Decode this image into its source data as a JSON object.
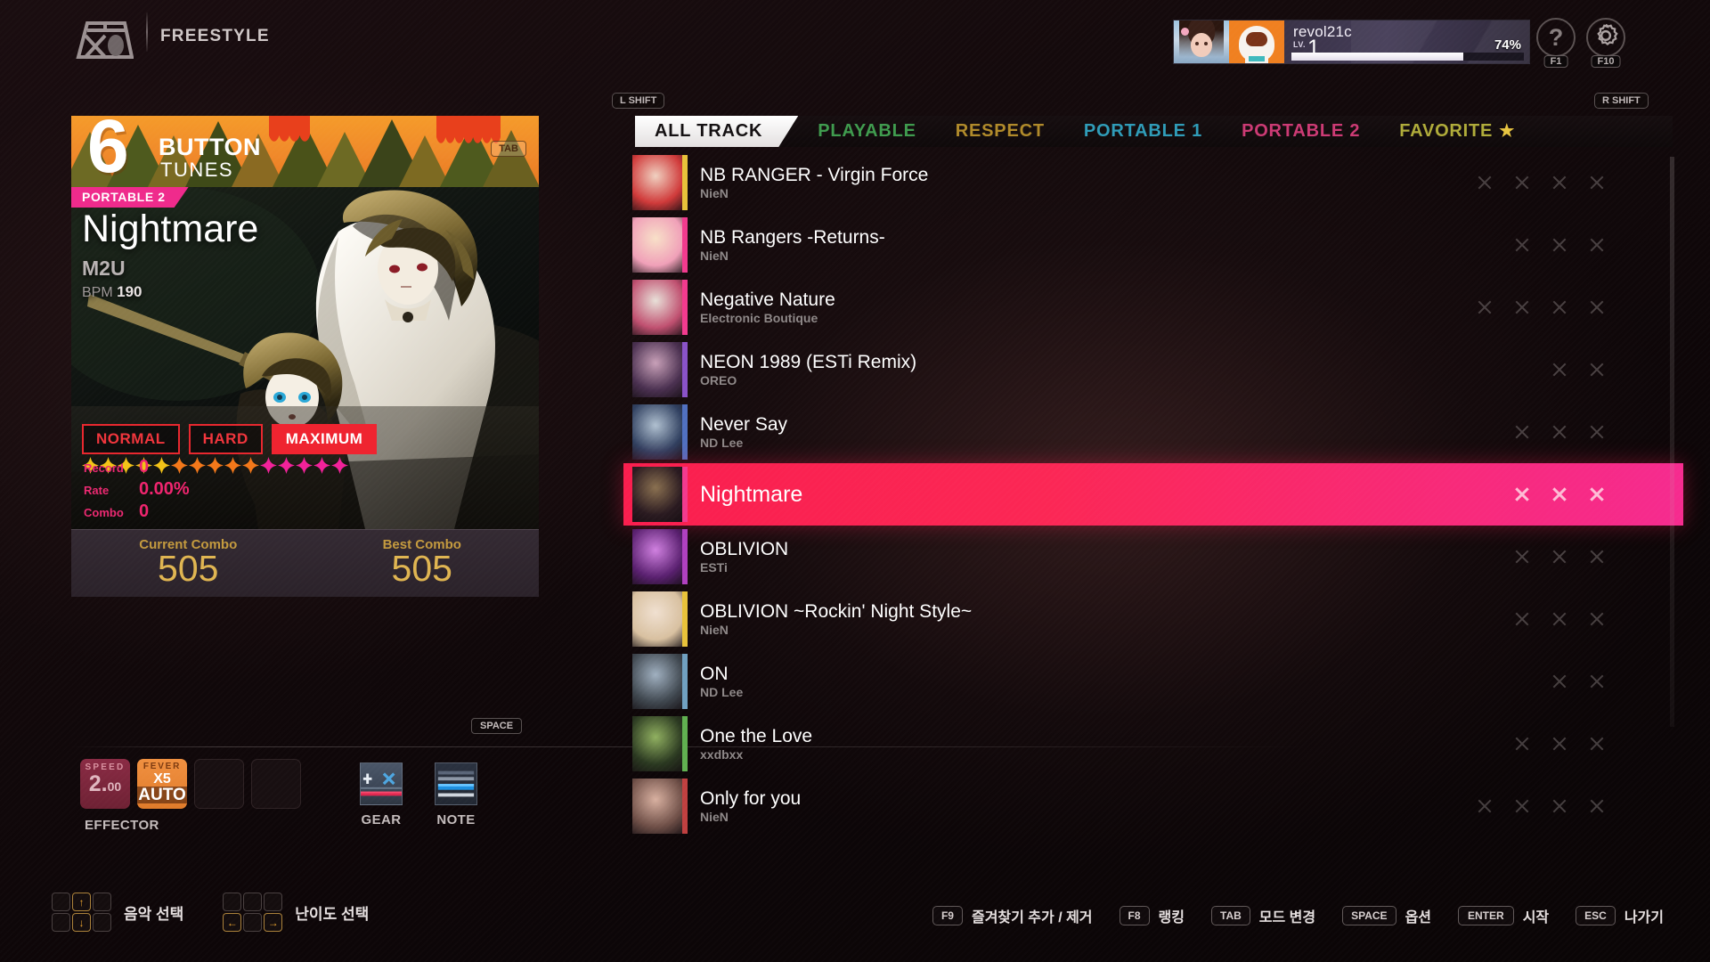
{
  "header": {
    "mode_label": "FREESTYLE",
    "mode_icon": "djmax-gear-logo-icon",
    "profile": {
      "name": "revol21c",
      "level_label": "LV.",
      "level_value": "1",
      "exp_percent_label": "74%",
      "exp_percent": 74
    },
    "help_button": {
      "glyph": "?",
      "key": "F1"
    },
    "settings_button": {
      "glyph": "gear",
      "key": "F10"
    }
  },
  "left_panel": {
    "banner": {
      "number": "6",
      "line1": "BUTTON",
      "line2": "TUNES",
      "key_hint": "TAB"
    },
    "song": {
      "category_badge": "PORTABLE 2",
      "title": "Nightmare",
      "artist": "M2U",
      "bpm_label": "BPM",
      "bpm_value": "190"
    },
    "difficulties": [
      {
        "label": "NORMAL",
        "selected": false
      },
      {
        "label": "HARD",
        "selected": false
      },
      {
        "label": "MAXIMUM",
        "selected": true
      }
    ],
    "star_rating": {
      "total": 15,
      "yellow": 5,
      "orange": 5,
      "pink": 5
    },
    "record": [
      {
        "label": "Record",
        "value": "0"
      },
      {
        "label": "Rate",
        "value": "0.00%"
      },
      {
        "label": "Combo",
        "value": "0"
      }
    ],
    "combo_panel": [
      {
        "label": "Current Combo",
        "value": "505"
      },
      {
        "label": "Best Combo",
        "value": "505"
      }
    ],
    "space_key_hint": "SPACE",
    "effector": {
      "label": "EFFECTOR",
      "slots": [
        {
          "type": "speed",
          "cap": "SPEED",
          "value": "2.",
          "value_small": "00"
        },
        {
          "type": "fever",
          "cap": "FEVER",
          "line1": "X5",
          "line2": "AUTO"
        },
        {
          "type": "empty"
        },
        {
          "type": "empty"
        }
      ]
    },
    "gear": {
      "label": "GEAR",
      "icon": "gear-skin-icon"
    },
    "note": {
      "label": "NOTE",
      "icon": "note-skin-icon"
    }
  },
  "tracklist": {
    "left_shift_key": "L SHIFT",
    "right_shift_key": "R SHIFT",
    "tabs": [
      {
        "label": "ALL TRACK",
        "state": "active"
      },
      {
        "label": "PLAYABLE",
        "state": "playable"
      },
      {
        "label": "RESPECT",
        "state": "respect"
      },
      {
        "label": "PORTABLE 1",
        "state": "p1"
      },
      {
        "label": "PORTABLE 2",
        "state": "p2"
      },
      {
        "label": "FAVORITE",
        "state": "fav",
        "star": "★"
      }
    ],
    "rows": [
      {
        "title": "NB RANGER - Virgin Force",
        "artist": "NieN",
        "edge": "#e8c23a",
        "thumb_a": "#d03a3a",
        "thumb_b": "#f0d0c0",
        "marks": 4,
        "selected": false
      },
      {
        "title": "NB Rangers -Returns-",
        "artist": "NieN",
        "edge": "#f23a8e",
        "thumb_a": "#f0a0b8",
        "thumb_b": "#f8e0c8",
        "marks": 3,
        "selected": false
      },
      {
        "title": "Negative Nature",
        "artist": "Electronic Boutique",
        "edge": "#f23a8e",
        "thumb_a": "#c05070",
        "thumb_b": "#e8e0d8",
        "marks": 4,
        "selected": false
      },
      {
        "title": "NEON 1989 (ESTi Remix)",
        "artist": "OREO",
        "edge": "#8a52c8",
        "thumb_a": "#4a3050",
        "thumb_b": "#c8a0b8",
        "marks": 2,
        "selected": false
      },
      {
        "title": "Never Say",
        "artist": "ND Lee",
        "edge": "#5070c0",
        "thumb_a": "#304060",
        "thumb_b": "#b0c0d0",
        "marks": 3,
        "selected": false
      },
      {
        "title": "Nightmare",
        "artist": "",
        "edge": "#f23a8e",
        "thumb_a": "#2a1a20",
        "thumb_b": "#8a7050",
        "marks": 3,
        "selected": true
      },
      {
        "title": "OBLIVION",
        "artist": "ESTi",
        "edge": "#b040c0",
        "thumb_a": "#5a2070",
        "thumb_b": "#d080e0",
        "marks": 3,
        "selected": false
      },
      {
        "title": "OBLIVION ~Rockin' Night Style~",
        "artist": "NieN",
        "edge": "#e8c23a",
        "thumb_a": "#d8c0a0",
        "thumb_b": "#f0e0d0",
        "marks": 3,
        "selected": false
      },
      {
        "title": "ON",
        "artist": "ND Lee",
        "edge": "#70a0c0",
        "thumb_a": "#404850",
        "thumb_b": "#a0b0c0",
        "marks": 2,
        "selected": false
      },
      {
        "title": "One the Love",
        "artist": "xxdbxx",
        "edge": "#60b050",
        "thumb_a": "#2a3820",
        "thumb_b": "#90b060",
        "marks": 3,
        "selected": false
      },
      {
        "title": "Only for you",
        "artist": "NieN",
        "edge": "#c04040",
        "thumb_a": "#705048",
        "thumb_b": "#d8b0a0",
        "marks": 4,
        "selected": false
      }
    ]
  },
  "bottom_bar": {
    "key_clusters": [
      {
        "label": "음악 선택",
        "type": "vertical"
      },
      {
        "label": "난이도 선택",
        "type": "horizontal"
      }
    ],
    "commands": [
      {
        "key": "F9",
        "text": "즐겨찾기 추가 / 제거"
      },
      {
        "key": "F8",
        "text": "랭킹"
      },
      {
        "key": "TAB",
        "text": "모드 변경"
      },
      {
        "key": "SPACE",
        "text": "옵션"
      },
      {
        "key": "ENTER",
        "text": "시작"
      },
      {
        "key": "ESC",
        "text": "나가기"
      }
    ]
  },
  "colors": {
    "selection_pink": "#fa1e4e",
    "accent_magenta": "#f0256f",
    "gold": "#e0b551",
    "banner_orange": "#f0892a"
  }
}
